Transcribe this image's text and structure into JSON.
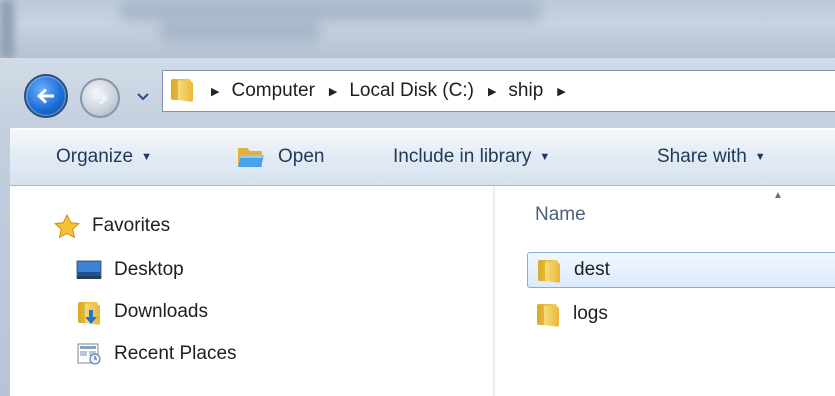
{
  "address": {
    "crumbs": [
      "Computer",
      "Local Disk (C:)",
      "ship"
    ]
  },
  "toolbar": {
    "organize_label": "Organize",
    "open_label": "Open",
    "include_label": "Include in library",
    "share_label": "Share with"
  },
  "navpane": {
    "favorites_label": "Favorites",
    "items": [
      {
        "label": "Desktop",
        "icon": "desktop-icon"
      },
      {
        "label": "Downloads",
        "icon": "downloads-folder-icon"
      },
      {
        "label": "Recent Places",
        "icon": "recent-places-icon"
      }
    ]
  },
  "filelist": {
    "column_name": "Name",
    "items": [
      {
        "name": "dest",
        "selected": true
      },
      {
        "name": "logs",
        "selected": false
      }
    ]
  },
  "colors": {
    "accent": "#1c6ed6",
    "selection_border": "#84acdd",
    "toolbar_text": "#1e395b"
  }
}
